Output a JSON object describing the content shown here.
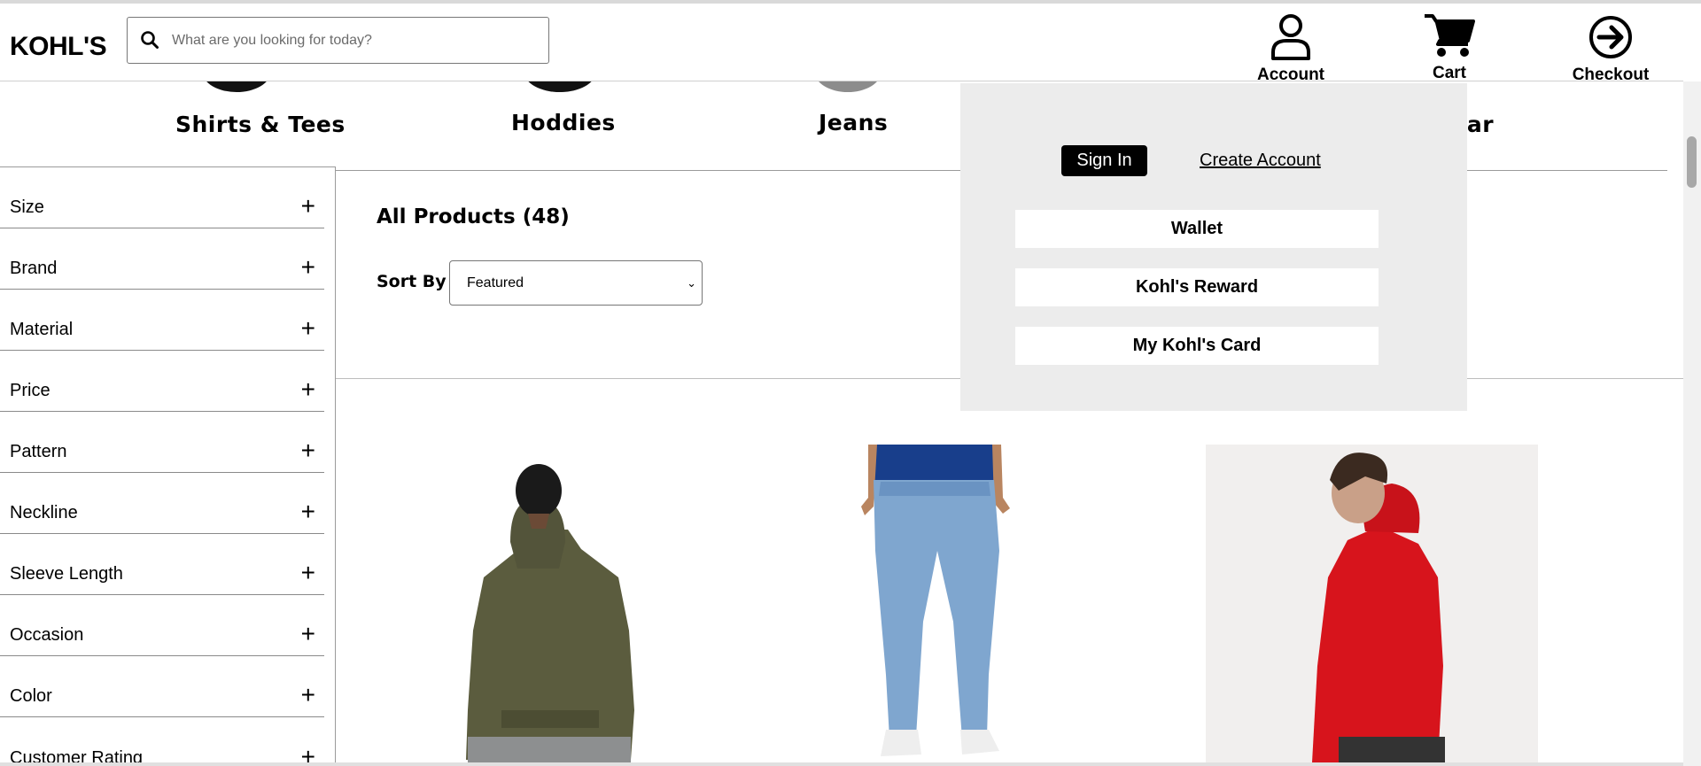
{
  "header": {
    "logo": "KOHL'S",
    "search_placeholder": "What are you looking for today?",
    "account_label": "Account",
    "cart_label": "Cart",
    "checkout_label": "Checkout"
  },
  "categories": [
    "Shirts & Tees",
    "Hoddies",
    "Jeans",
    "Vear"
  ],
  "filters": [
    "Size",
    "Brand",
    "Material",
    "Price",
    "Pattern",
    "Neckline",
    "Sleeve Length",
    "Occasion",
    "Color",
    "Customer Rating"
  ],
  "main": {
    "title": "All Products (48)",
    "sort_label": "Sort By",
    "sort_value": "Featured"
  },
  "account_menu": {
    "sign_in": "Sign In",
    "create_account": "Create Account",
    "items": [
      "Wallet",
      "Kohl's Reward",
      "My Kohl's Card"
    ]
  },
  "colors": {
    "dropdown_bg": "#ececec",
    "product_1_hoodie": "#5b5c3e",
    "product_2_jeans": "#7fa6cf",
    "product_3_hoodie": "#d7141c"
  }
}
